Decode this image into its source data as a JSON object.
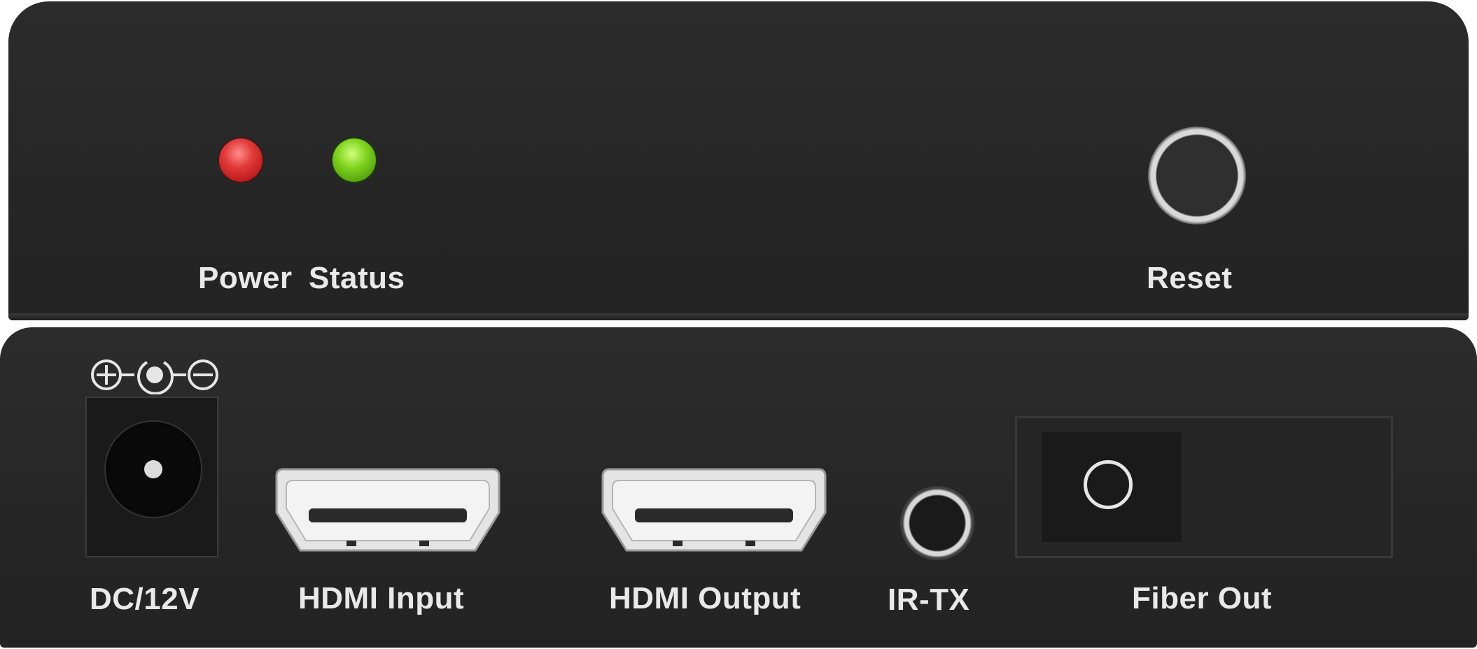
{
  "front": {
    "power_label": "Power",
    "status_label": "Status",
    "reset_label": "Reset"
  },
  "back": {
    "dc_label": "DC/12V",
    "hdmi_input_label": "HDMI Input",
    "hdmi_output_label": "HDMI Output",
    "ir_label": "IR-TX",
    "fiber_label": "Fiber Out"
  },
  "leds": {
    "power_color": "#e23a3a",
    "status_color": "#7fd21e"
  },
  "icons": {
    "polarity": "dc-polarity-icon",
    "hdmi": "hdmi-port-icon"
  }
}
